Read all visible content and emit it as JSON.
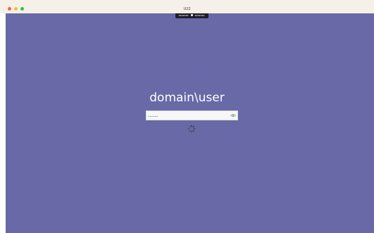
{
  "window": {
    "title": "U22"
  },
  "login": {
    "username": "domain\\user",
    "password_mask": "••••••"
  },
  "icons": {
    "close": "close-dot",
    "minimize": "minimize-dot",
    "maximize": "maximize-dot",
    "visibility": "eye-icon",
    "loading": "spinner-icon",
    "toolbar": "remote-toolbar-pin"
  },
  "colors": {
    "background": "#6869a6",
    "titlebar": "#f5f0e8",
    "input": "#f7f7f7",
    "text": "#ffffff"
  }
}
